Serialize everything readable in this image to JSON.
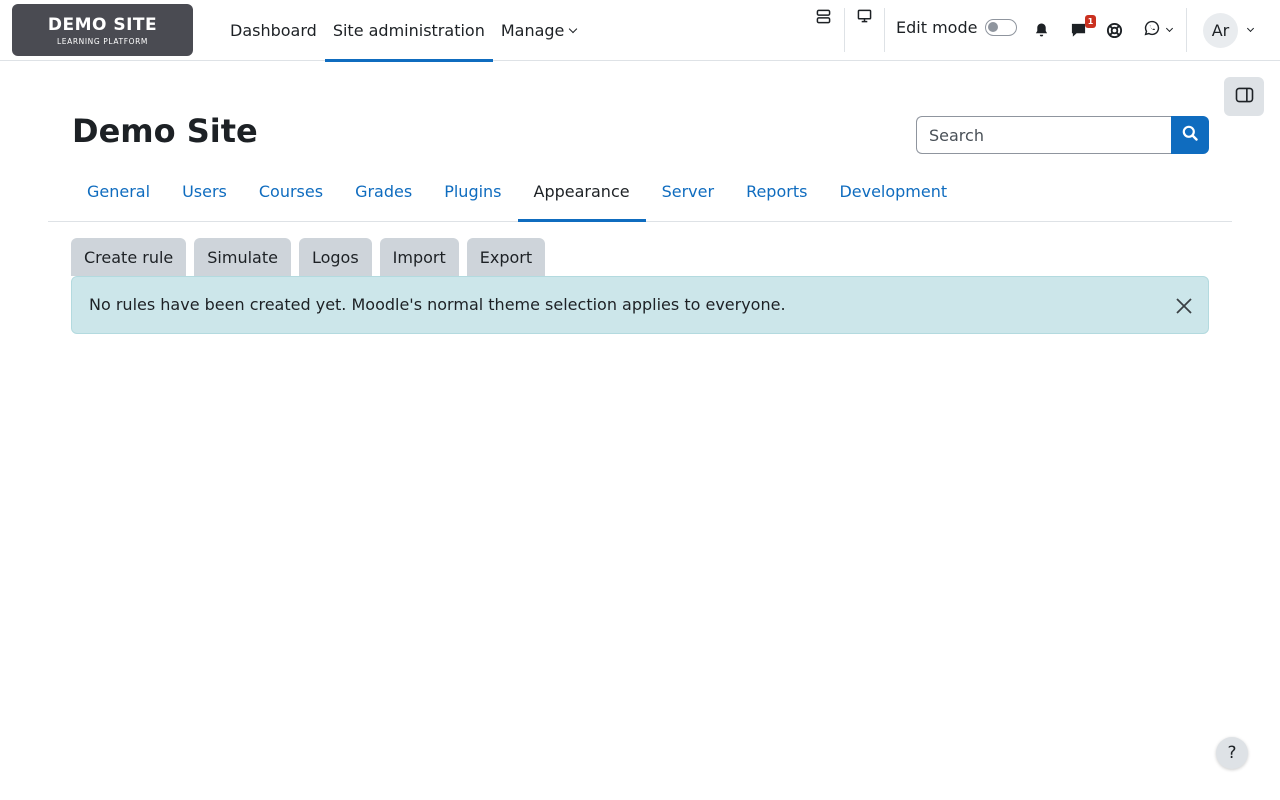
{
  "logo": {
    "title": "DEMO SITE",
    "subtitle": "LEARNING PLATFORM"
  },
  "primary_nav": {
    "items": [
      {
        "label": "Dashboard"
      },
      {
        "label": "Site administration",
        "active": true
      },
      {
        "label": "Manage",
        "dropdown": true
      }
    ]
  },
  "navbar_right": {
    "edit_mode_label": "Edit mode",
    "edit_mode_on": false,
    "messages_badge": "1",
    "avatar_initials": "Ar",
    "icons": [
      "layout-icon",
      "desktop-icon",
      "bell-icon",
      "chat-icon",
      "lifebuoy-icon",
      "whatsapp-icon"
    ]
  },
  "page": {
    "title": "Demo Site"
  },
  "search": {
    "placeholder": "Search"
  },
  "tabs": [
    {
      "label": "General"
    },
    {
      "label": "Users"
    },
    {
      "label": "Courses"
    },
    {
      "label": "Grades"
    },
    {
      "label": "Plugins"
    },
    {
      "label": "Appearance",
      "active": true
    },
    {
      "label": "Server"
    },
    {
      "label": "Reports"
    },
    {
      "label": "Development"
    }
  ],
  "actions": [
    {
      "label": "Create rule"
    },
    {
      "label": "Simulate"
    },
    {
      "label": "Logos"
    },
    {
      "label": "Import"
    },
    {
      "label": "Export"
    }
  ],
  "alert": {
    "message": "No rules have been created yet. Moodle's normal theme selection applies to everyone."
  },
  "help": {
    "label": "?"
  },
  "colors": {
    "primary": "#0f6cbf",
    "alert_bg": "#cce6ea",
    "badge": "#ca3120",
    "logo_bg": "#4a4b52"
  }
}
